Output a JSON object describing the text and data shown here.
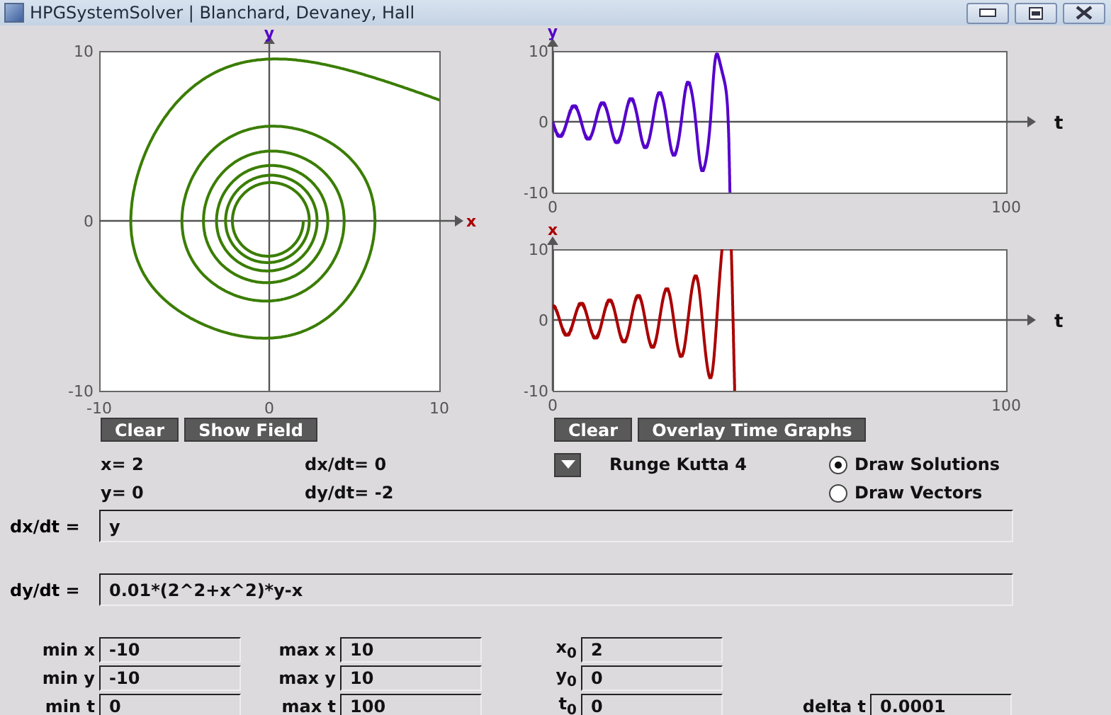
{
  "window": {
    "title": "HPGSystemSolver | Blanchard, Devaney, Hall"
  },
  "phase_plot": {
    "x_axis_label": "x",
    "y_axis_label": "y",
    "x_ticks": [
      "-10",
      "0",
      "10"
    ],
    "y_ticks": [
      "10",
      "0",
      "-10"
    ]
  },
  "time_plots": [
    {
      "variable_label": "y",
      "t_label": "t",
      "y_ticks": [
        "10",
        "0",
        "-10"
      ],
      "t_ticks": [
        "0",
        "100"
      ],
      "color": "#5500cc"
    },
    {
      "variable_label": "x",
      "t_label": "t",
      "y_ticks": [
        "10",
        "0",
        "-10"
      ],
      "t_ticks": [
        "0",
        "100"
      ],
      "color": "#aa0000"
    }
  ],
  "phase_buttons": [
    "Clear",
    "Show Field"
  ],
  "time_buttons": [
    "Clear",
    "Overlay Time Graphs"
  ],
  "readouts": [
    {
      "point": "x= 2",
      "derivative": "dx/dt= 0"
    },
    {
      "point": "y= 0",
      "derivative": "dy/dt= -2"
    }
  ],
  "method": {
    "value": "Runge Kutta 4"
  },
  "draw_mode": [
    {
      "label": "Draw Solutions",
      "selected": true
    },
    {
      "label": "Draw Vectors",
      "selected": false
    }
  ],
  "equations": [
    {
      "label": "dx/dt =",
      "value": "y"
    },
    {
      "label": "dy/dt =",
      "value": "0.01*(2^2+x^2)*y-x"
    }
  ],
  "parameter_rows": [
    {
      "fields": [
        {
          "label": "min x",
          "value": "-10"
        },
        {
          "label": "max x",
          "value": "10"
        },
        {
          "label": "x$_{0}$",
          "value": "2"
        }
      ]
    },
    {
      "fields": [
        {
          "label": "min y",
          "value": "-10"
        },
        {
          "label": "max y",
          "value": "10"
        },
        {
          "label": "y$_{0}$",
          "value": "0"
        }
      ]
    },
    {
      "fields": [
        {
          "label": "min t",
          "value": "0"
        },
        {
          "label": "max t",
          "value": "100"
        },
        {
          "label": "t$_{0}$",
          "value": "0"
        },
        {
          "label": "delta t",
          "value": "0.0001"
        }
      ]
    }
  ]
}
